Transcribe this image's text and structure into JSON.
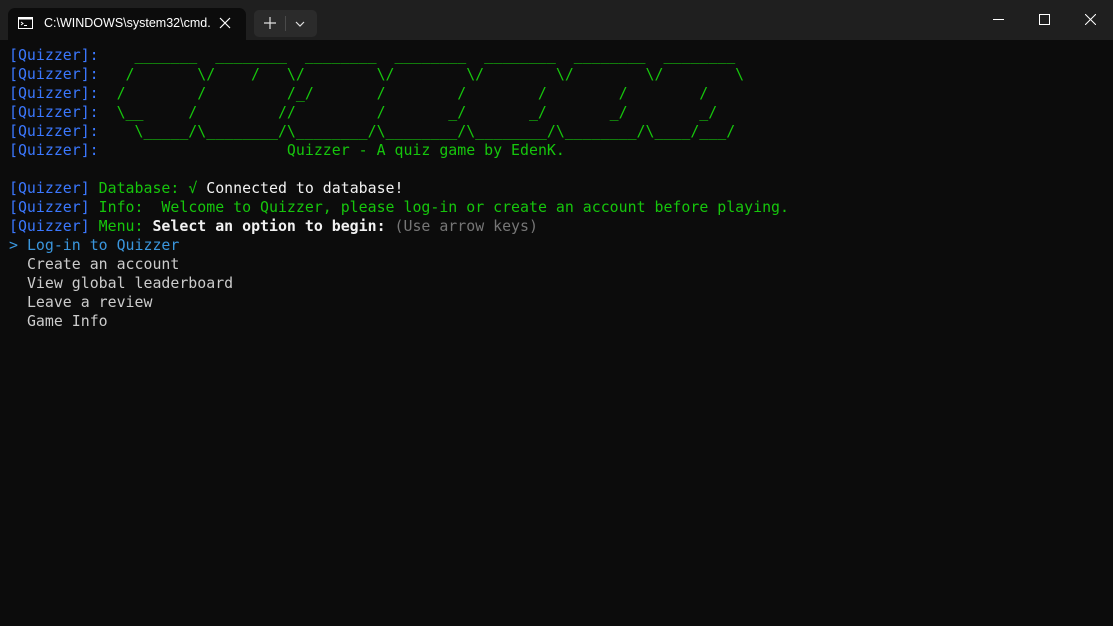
{
  "window": {
    "tab_title": "C:\\WINDOWS\\system32\\cmd.",
    "tab_icon": "cmd-icon",
    "buttons": [
      "new-tab-icon",
      "dropdown-chevron-icon",
      "minimize-icon",
      "maximize-icon",
      "close-icon"
    ]
  },
  "terminal": {
    "prefix": "[Quizzer]",
    "banner": [
      "[Quizzer]:    _______  ________  ________  ________  ________  ________  ________ ",
      "[Quizzer]:   /       \\/    /   \\/        \\/        \\/        \\/        \\/        \\",
      "[Quizzer]:  /        /         /_/       /        /        /        /        /",
      "[Quizzer]:  \\__     /         //         /       _/       _/       _/        _/",
      "[Quizzer]:    \\_____/\\________/\\________/\\________/\\________/\\________/\\____/___/"
    ],
    "banner_last_prefix": "[Quizzer]:",
    "tagline": "Quizzer - A quiz game by EdenK.",
    "database_label": "Database:",
    "database_check": "√",
    "database_message": "Connected to database!",
    "info_label": "Info:",
    "info_message": "Welcome to Quizzer, please log-in or create an account before playing.",
    "menu_label": "Menu:",
    "menu_prompt": "Select an option to begin:",
    "menu_hint": "(Use arrow keys)",
    "cursor": ">",
    "options": [
      "Log-in to Quizzer",
      "Create an account",
      "View global leaderboard",
      "Leave a review",
      "Game Info"
    ],
    "selected_option": "Log-in to Quizzer"
  },
  "colors": {
    "background": "#0c0c0c",
    "titlebar": "#1f1f1f",
    "prefix_blue": "#3b78ff",
    "banner_green": "#16c60c",
    "selected_cyan": "#3a96dd",
    "hint_gray": "#767676"
  }
}
